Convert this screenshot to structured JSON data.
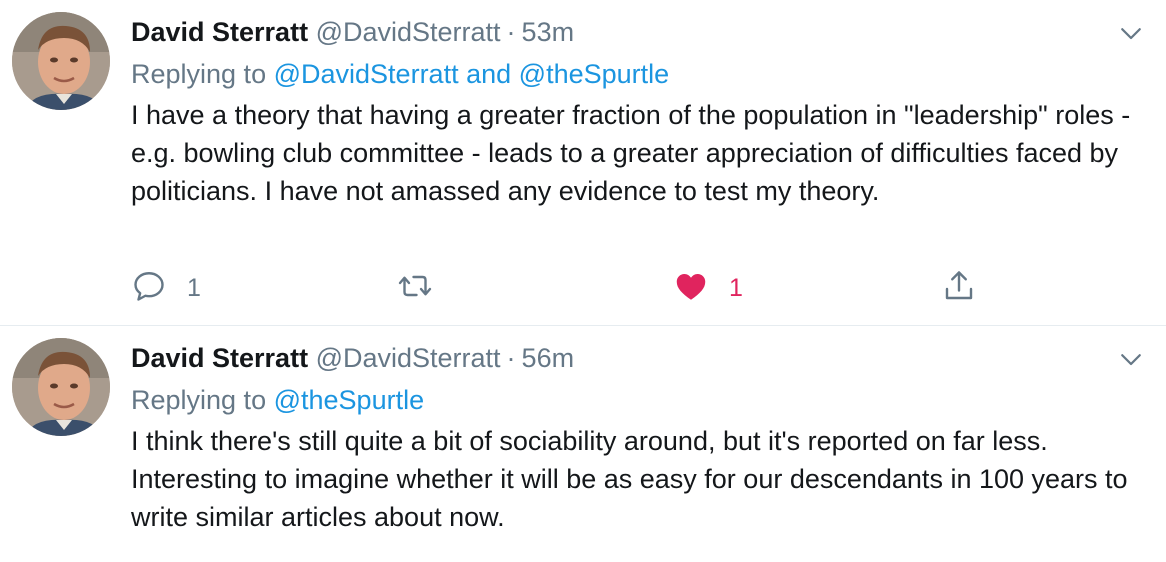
{
  "tweets": [
    {
      "name": "David Sterratt",
      "handle": "@DavidSterratt",
      "separator": "·",
      "time": "53m",
      "replying_prefix": "Replying to",
      "replying_to_1": "@DavidSterratt",
      "replying_and": "and",
      "replying_to_2": "@theSpurtle",
      "body": "I have a theory that having a greater fraction of the population in \"leadership\" roles - e.g. bowling club committee - leads to a greater appreciation of difficulties faced by politicians. I have not amassed any evidence to test my theory.",
      "reply_count": "1",
      "like_count": "1",
      "liked": true
    },
    {
      "name": "David Sterratt",
      "handle": "@DavidSterratt",
      "separator": "·",
      "time": "56m",
      "replying_prefix": "Replying to",
      "replying_to_1": "@theSpurtle",
      "body": "I think there's still quite a bit of sociability around, but it's reported on far less. Interesting to imagine whether it will be as easy for our descendants in 100 years to write similar articles about now."
    }
  ],
  "colors": {
    "link": "#1b95e0",
    "secondary": "#657786",
    "like": "#e0245e",
    "divider": "#e6ecf0"
  },
  "icons": [
    "avatar",
    "chevron-down-icon",
    "reply-icon",
    "retweet-icon",
    "heart-icon",
    "share-icon"
  ]
}
